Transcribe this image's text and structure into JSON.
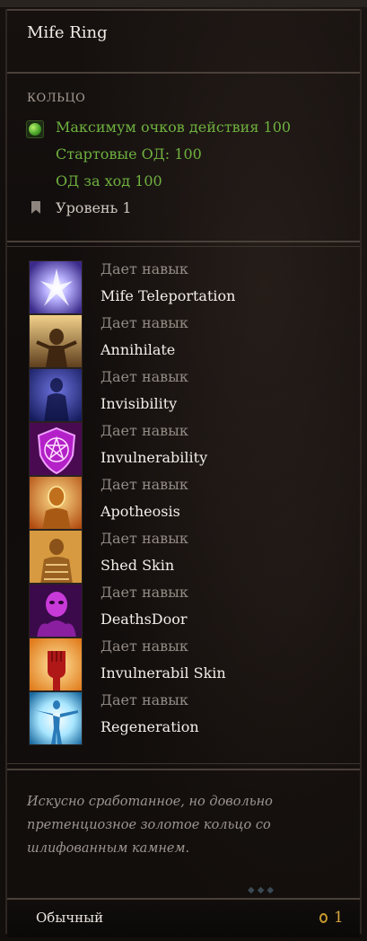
{
  "item": {
    "title": "Mife Ring",
    "category": "КОЛЬЦО",
    "stats": [
      "Максимум очков действия 100",
      "Стартовые ОД: 100",
      "ОД за ход 100"
    ],
    "level": "Уровень 1"
  },
  "skills": [
    {
      "sub": "Дает навык",
      "name": "Mife Teleportation",
      "icon": "teleport-icon"
    },
    {
      "sub": "Дает навык",
      "name": "Annihilate",
      "icon": "annihilate-icon"
    },
    {
      "sub": "Дает навык",
      "name": "Invisibility",
      "icon": "invisibility-icon"
    },
    {
      "sub": "Дает навык",
      "name": "Invulnerability",
      "icon": "pentagram-shield-icon"
    },
    {
      "sub": "Дает навык",
      "name": "Apotheosis",
      "icon": "apotheosis-icon"
    },
    {
      "sub": "Дает навык",
      "name": "Shed Skin",
      "icon": "shed-skin-icon"
    },
    {
      "sub": "Дает навык",
      "name": "DeathsDoor",
      "icon": "deaths-door-icon"
    },
    {
      "sub": "Дает навык",
      "name": "Invulnerabil Skin",
      "icon": "fist-icon"
    },
    {
      "sub": "Дает навык",
      "name": "Regeneration",
      "icon": "regeneration-icon"
    }
  ],
  "description": "Искусно сработанное, но довольно претенциозное золотое кольцо со шлифованным камнем.",
  "footer": {
    "rarity": "Обычный",
    "price": "1"
  },
  "colors": {
    "stat_green": "#6fb13f",
    "gold": "#d7a640"
  }
}
